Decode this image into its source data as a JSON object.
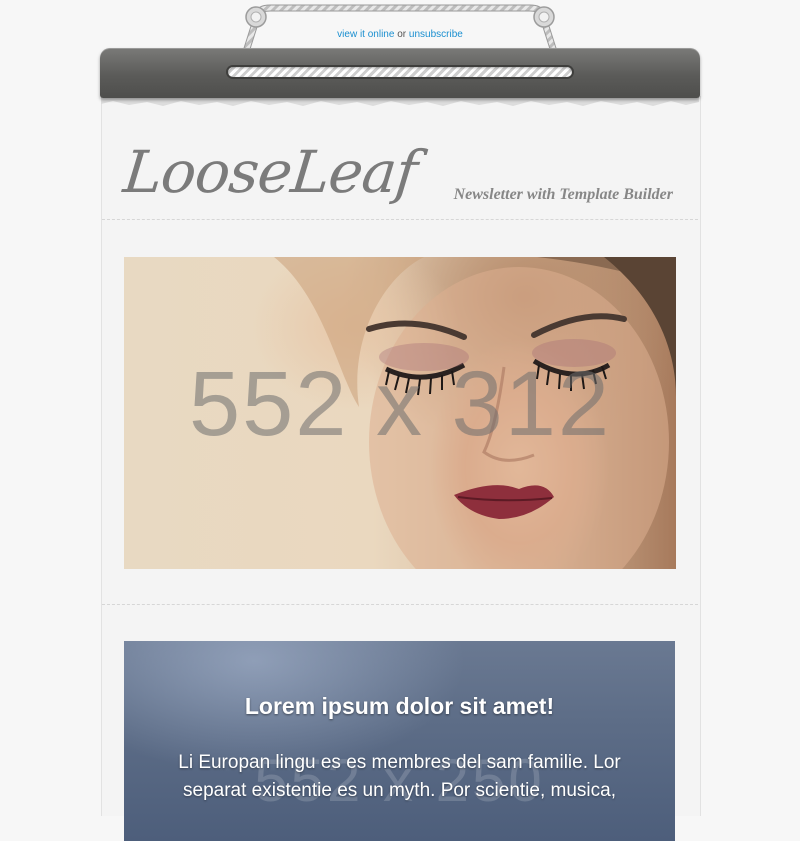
{
  "header_links": {
    "view_online": "view it online",
    "separator": "or",
    "unsubscribe": "unsubscribe"
  },
  "brand": {
    "logo_text": "LooseLeaf",
    "tagline": "Newsletter with Template Builder"
  },
  "hero_image": {
    "placeholder_text": "552 x 312"
  },
  "feature_card": {
    "title": "Lorem ipsum dolor sit amet!",
    "body": "Li Europan lingu es es membres del sam familie. Lor separat existentie es un myth. Por scientie, musica,",
    "placeholder_text": "552 x 250"
  },
  "colors": {
    "link": "#1a8fd0",
    "binder": "#5b5b59",
    "paper": "#f4f4f4",
    "logo": "#7b7b7b",
    "tagline": "#878787"
  }
}
